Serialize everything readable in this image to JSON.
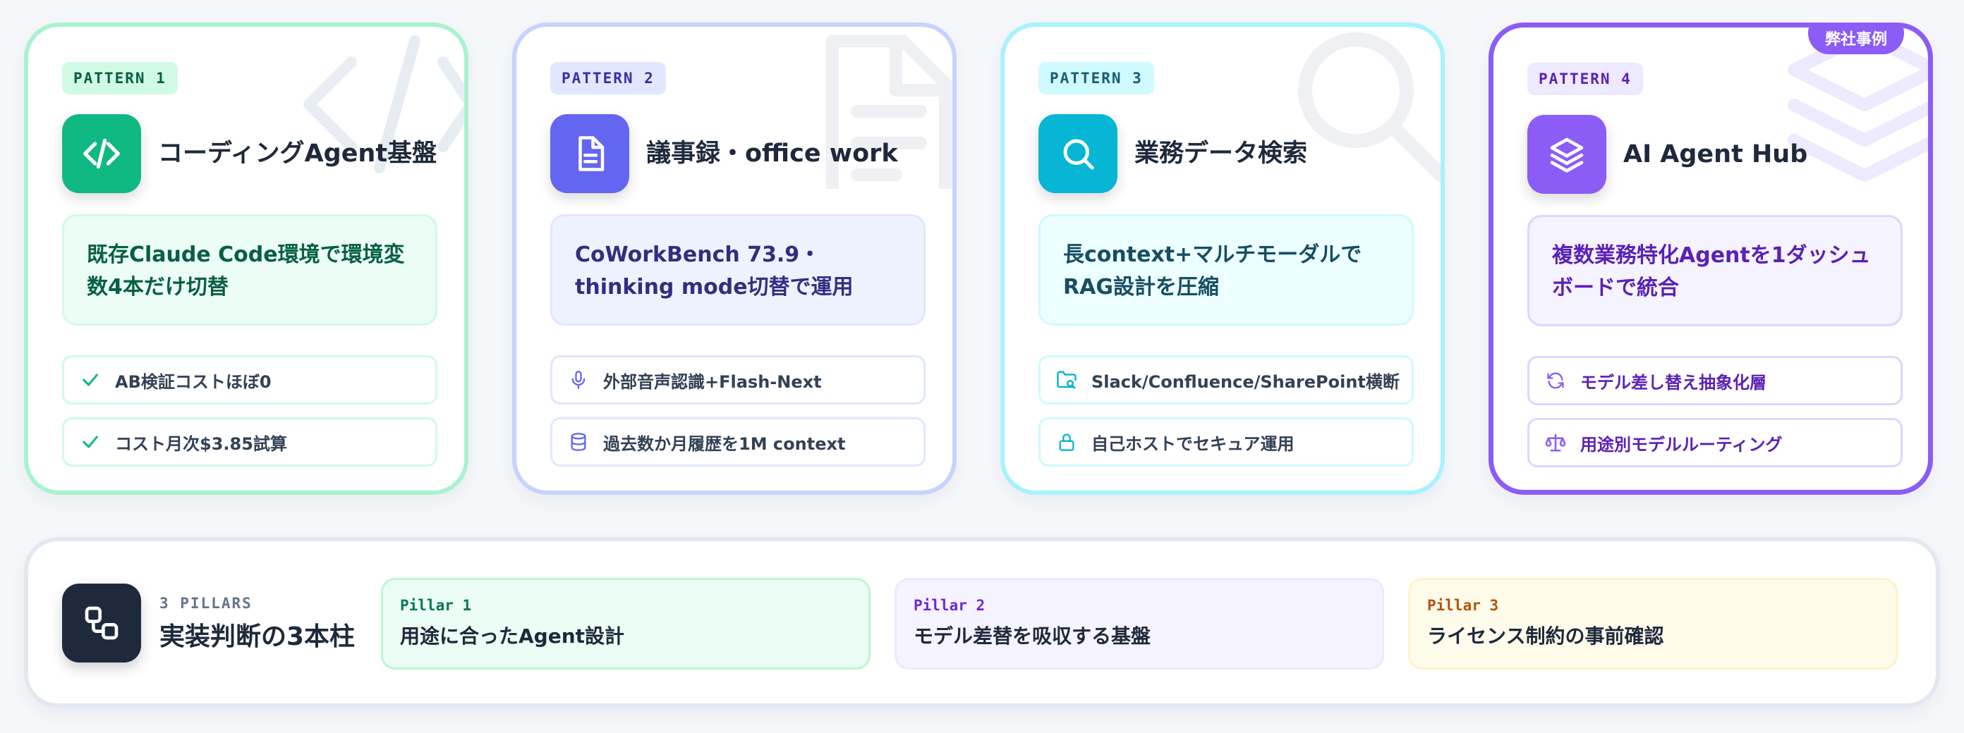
{
  "cards": [
    {
      "tag": "PATTERN 1",
      "title": "コーディングAgent基盤",
      "description": "既存Claude Code環境で環境変数4本だけ切替",
      "features": [
        "AB検証コストほぼ0",
        "コスト月次$3.85試算"
      ]
    },
    {
      "tag": "PATTERN 2",
      "title": "議事録・office work",
      "description": "CoWorkBench 73.9・thinking mode切替で運用",
      "features": [
        "外部音声認識+Flash-Next",
        "過去数か月履歴を1M context"
      ]
    },
    {
      "tag": "PATTERN 3",
      "title": "業務データ検索",
      "description": "長context+マルチモーダルでRAG設計を圧縮",
      "features": [
        "Slack/Confluence/SharePoint横断",
        "自己ホストでセキュア運用"
      ]
    },
    {
      "tag": "PATTERN 4",
      "badge": "弊社事例",
      "title": "AI Agent Hub",
      "description": "複数業務特化Agentを1ダッシュボードで統合",
      "features": [
        "モデル差し替え抽象化層",
        "用途別モデルルーティング"
      ]
    }
  ],
  "pillars": {
    "kicker": "3 PILLARS",
    "title": "実装判断の3本柱",
    "items": [
      {
        "label": "Pillar 1",
        "text": "用途に合ったAgent設計"
      },
      {
        "label": "Pillar 2",
        "text": "モデル差替を吸収する基盤"
      },
      {
        "label": "Pillar 3",
        "text": "ライセンス制約の事前確認"
      }
    ]
  },
  "colors": {
    "green": "#10b981",
    "indigo": "#6366f1",
    "cyan": "#06b6d4",
    "violet": "#8b5cf6",
    "dark": "#1e293b"
  }
}
